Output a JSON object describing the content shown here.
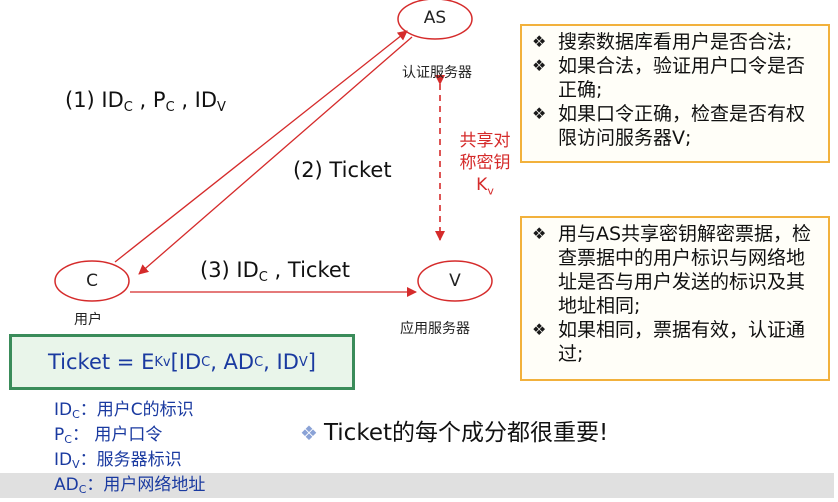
{
  "nodes": {
    "as": {
      "label": "AS",
      "caption": "认证服务器"
    },
    "c": {
      "label": "C",
      "caption": "用户"
    },
    "v": {
      "label": "V",
      "caption": "应用服务器"
    }
  },
  "messages": {
    "m1": {
      "prefix": "(1) ID",
      "sub1": "C",
      "mid1": " , P",
      "sub2": "C",
      "mid2": " , ID",
      "sub3": "V"
    },
    "m2": {
      "text": "(2) Ticket"
    },
    "m3": {
      "prefix": "(3) ID",
      "sub1": "C",
      "suffix": " , Ticket"
    }
  },
  "shared_key": {
    "line1": "共享对",
    "line2": "称密钥",
    "k": "K",
    "k_sub": "v"
  },
  "as_notes": [
    "搜索数据库看用户是否合法;",
    "如果合法，验证用户口令是否正确;",
    "如果口令正确，检查是否有权限访问服务器V;"
  ],
  "v_notes": [
    "用与AS共享密钥解密票据，检查票据中的用户标识与网络地址是否与用户发送的标识及其地址相同;",
    "如果相同，票据有效，认证通过;"
  ],
  "ticket_formula": {
    "lhs": "Ticket  =  E",
    "e_sub": "Kv",
    "p1": "[ID",
    "s1": "C",
    "p2": " , AD",
    "s2": "C",
    "p3": " , ID",
    "s3": "V",
    "p4": "]"
  },
  "legend": [
    {
      "sym": "ID",
      "sub": "C",
      "text": "：用户C的标识"
    },
    {
      "sym": "P",
      "sub": "C",
      "text": "： 用户口令"
    },
    {
      "sym": "ID",
      "sub": "V",
      "text": "：服务器标识"
    },
    {
      "sym": "AD",
      "sub": "C",
      "text": "：用户网络地址"
    }
  ],
  "bottom_note": "Ticket的每个成分都很重要!",
  "colors": {
    "arrow_red": "#d52b2b",
    "box_border_orange": "#f2b13c",
    "formula_border_green": "#3a8c5a",
    "legend_blue": "#1a3aa0"
  }
}
